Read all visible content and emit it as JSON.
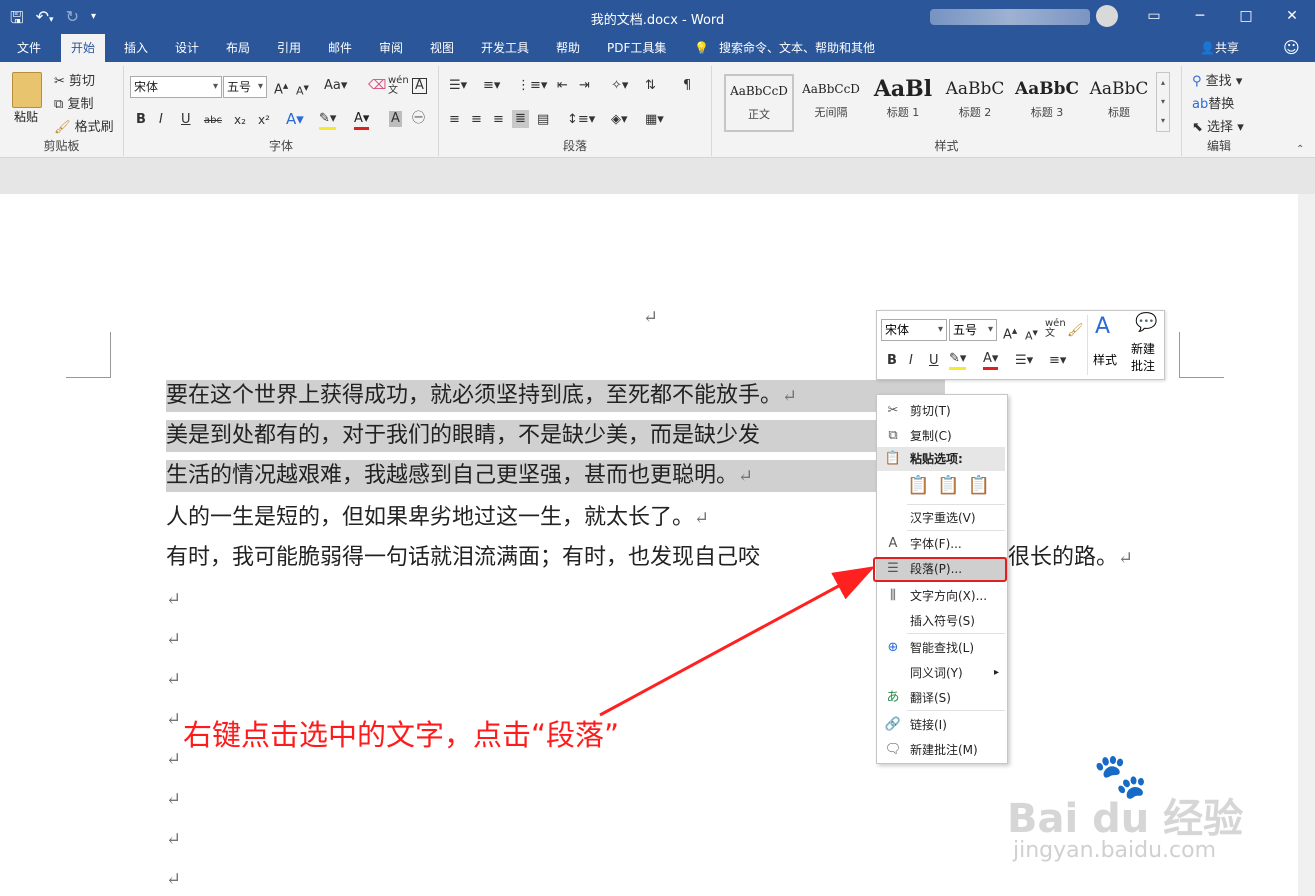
{
  "window": {
    "title": "我的文档.docx - Word",
    "minimize": "─",
    "restore": "□",
    "close": "✕",
    "ribbon_opts": "▭"
  },
  "qat": {
    "save": "🖫",
    "undo": "↶",
    "undo_arrow": "▾",
    "redo": "↻",
    "more": "▾"
  },
  "tabs": [
    "文件",
    "开始",
    "插入",
    "设计",
    "布局",
    "引用",
    "邮件",
    "审阅",
    "视图",
    "开发工具",
    "帮助",
    "PDF工具集"
  ],
  "tell_me": "搜索命令、文本、帮助和其他",
  "share": "共享",
  "ribbon": {
    "clipboard": {
      "paste": "粘贴",
      "cut": "剪切",
      "copy": "复制",
      "format_painter": "格式刷",
      "label": "剪贴板"
    },
    "font": {
      "name": "宋体",
      "size": "五号",
      "label": "字体",
      "bold": "B",
      "italic": "I",
      "underline": "U",
      "strike": "abc",
      "sub": "x₂",
      "sup": "x²"
    },
    "paragraph": {
      "label": "段落"
    },
    "styles": {
      "label": "样式",
      "items": [
        {
          "sample": "AaBbCcD",
          "name": "正文"
        },
        {
          "sample": "AaBbCcD",
          "name": "无间隔"
        },
        {
          "sample": "AaBl",
          "name": "标题 1"
        },
        {
          "sample": "AaBbC",
          "name": "标题 2"
        },
        {
          "sample": "AaBbC",
          "name": "标题 3"
        },
        {
          "sample": "AaBbC",
          "name": "标题"
        }
      ]
    },
    "editing": {
      "find": "查找",
      "replace": "替换",
      "select": "选择",
      "label": "编辑"
    }
  },
  "doc": {
    "lines": [
      "要在这个世界上获得成功，就必须坚持到底，至死都不能放手。",
      "美是到处都有的，对于我们的眼睛，不是缺少美，而是缺少发",
      "生活的情况越艰难，我越感到自己更坚强，甚而也更聪明。",
      "人的一生是短的，但如果卑劣地过这一生，就太长了。",
      "有时，我可能脆弱得一句话就泪流满面；有时，也发现自己咬",
      "很长的路。"
    ],
    "para_mark": "↵"
  },
  "mini_toolbar": {
    "font": "宋体",
    "size": "五号",
    "styles": "样式",
    "new_comment": "新建批注"
  },
  "context_menu": {
    "items": [
      "剪切(T)",
      "复制(C)",
      "粘贴选项:",
      "汉字重选(V)",
      "字体(F)...",
      "段落(P)...",
      "文字方向(X)...",
      "插入符号(S)",
      "智能查找(L)",
      "同义词(Y)",
      "翻译(S)",
      "链接(I)",
      "新建批注(M)"
    ],
    "submenu_arrow": "▸"
  },
  "annotation": "右键点击选中的文字，点击“段落”",
  "watermark": {
    "logo": "Bai du 经验",
    "url": "jingyan.baidu.com"
  },
  "colors": {
    "titlebar": "#2b579a",
    "annotation": "#ff1b1b",
    "selection": "#d0d0d0"
  }
}
